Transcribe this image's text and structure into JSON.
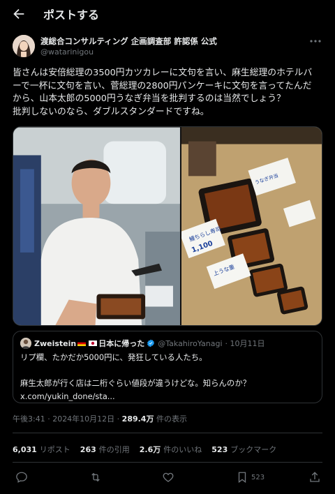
{
  "header": {
    "title": "ポストする"
  },
  "author": {
    "name": "渡総合コンサルティング 企画調査部 許認係 公式",
    "handle": "@watarinigou"
  },
  "post": {
    "lines": [
      "皆さんは安倍総理の3500円カツカレーに文句を言い、麻生総理のホテルバ",
      "ーで一杯に文句を言い、菅総理の2800円パンケーキに文句を言ってたんだ",
      "から、山本太郎の5000円うなぎ弁当を批判するのは当然でしょう？",
      "批判しないのなら、ダブルスタンダードですね。"
    ]
  },
  "media": {
    "right_signs": [
      "鰻ちらし寿司",
      "上うな重",
      "1,100",
      "うなぎ弁当"
    ]
  },
  "quote": {
    "name": "Zweistein",
    "name_suffix": "日本に帰った",
    "handle": "@TakahiroYanagi",
    "date": "· 10月11日",
    "lines": [
      "リプ欄、たかだか5000円に、発狂している人たち。",
      "",
      "麻生太郎が行く店は二桁ぐらい値段が違うけどな。知らんのか？",
      "x.com/yukin_done/sta..."
    ]
  },
  "meta": {
    "time": "午後3:41 · 2024年10月12日 · ",
    "views": "289.4万",
    "views_label": " 件の表示"
  },
  "stats": {
    "reposts": "6,031",
    "reposts_label": "リポスト",
    "quotes": "263",
    "quotes_label": "件の引用",
    "likes": "2.6万",
    "likes_label": "件のいいね",
    "bookmarks": "523",
    "bookmarks_label": "ブックマーク"
  },
  "actions": {
    "bookmark_count": "523"
  },
  "colors": {
    "background": "#000000",
    "text": "#e7e9ea",
    "muted": "#71767b",
    "border": "#2f3336",
    "verified": "#1d9bf0"
  }
}
